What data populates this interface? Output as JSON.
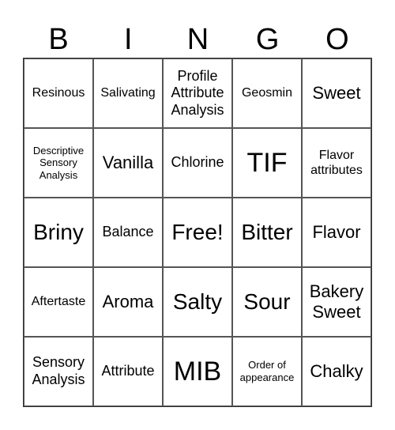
{
  "header": [
    "B",
    "I",
    "N",
    "G",
    "O"
  ],
  "cells": [
    "Resinous",
    "Salivating",
    "Profile Attribute Analysis",
    "Geosmin",
    "Sweet",
    "Descriptive Sensory Analysis",
    "Vanilla",
    "Chlorine",
    "TIF",
    "Flavor attributes",
    "Briny",
    "Balance",
    "Free!",
    "Bitter",
    "Flavor",
    "Aftertaste",
    "Aroma",
    "Salty",
    "Sour",
    "Bakery Sweet",
    "Sensory Analysis",
    "Attribute",
    "MIB",
    "Order of appearance",
    "Chalky"
  ]
}
